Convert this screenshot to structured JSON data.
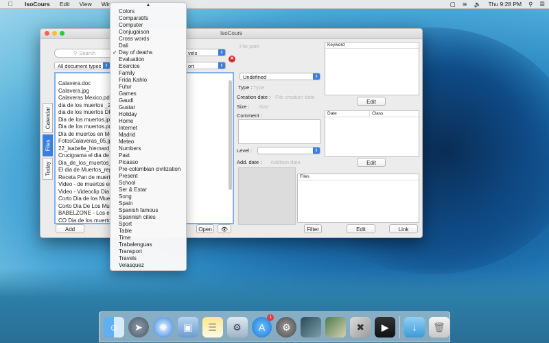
{
  "menubar": {
    "app_name": "IsoCours",
    "menus": [
      "Edit",
      "View",
      "Window"
    ],
    "clock": "Thu 9:28 PM"
  },
  "window": {
    "title": "IsoCours",
    "side_tabs": [
      "Calendar",
      "Files",
      "Today"
    ],
    "search_placeholder": "Search",
    "doc_type_select": "All document types",
    "level_select_partial": "vels",
    "sort_select_partial": "ort",
    "files": [
      "Calavera.doc",
      "Calavera.jpg",
      "Calaveras Mexico.pdf",
      "dia de los muertos _2.p",
      "dia de los muertos DF.j",
      "Dia de los muertos.jpg",
      "Dia de los muertos.pdf",
      "Dia de muertos en Mex",
      "FotosCalaveras_05.jpg",
      "22_isabelle_hiernard_d",
      "Crucigrama el dia de m",
      "Dia_de_los_muertos_",
      "El dia de Muertos_repa",
      "Receta Pan de muertos",
      "Video - de muertos en.",
      "Video - Videoclip Dia d",
      "Corto Dia de los Muert",
      "Corto Dia De Los Muer",
      "BABELZONE - Los esq",
      "CO Dia de los muertos"
    ],
    "buttons": {
      "add": "Add",
      "open": "Open",
      "edit_keyword": "Edit",
      "edit_date": "Edit",
      "filter": "Filter",
      "edit_files": "Edit",
      "link": "Link"
    },
    "detail": {
      "file_path_label": "File path",
      "status_select": "Undefined",
      "type_label": "Type :",
      "type_value": "Type",
      "creation_label": "Creation date :",
      "creation_value": "File creation date",
      "size_label": "Size :",
      "size_value": "Size",
      "comment_label": "Comment :",
      "level_label": "Level :",
      "add_date_label": "Add. date :",
      "add_date_value": "Addition date"
    },
    "tables": {
      "keyword_header": "Keyword",
      "date_header": "Date",
      "class_header": "Class",
      "files_header": "Files"
    }
  },
  "dropdown": {
    "checked": "Day of deaths",
    "options": [
      "Colors",
      "Comparatifs",
      "Computer",
      "Conjugaison",
      "Cross words",
      "Dali",
      "Day of deaths",
      "Evaluation",
      "Exercice",
      "Family",
      "Frida Kahlo",
      "Futur",
      "Games",
      "Gaudi",
      "Gustar",
      "Holiday",
      "Home",
      "Internet",
      "Madrid",
      "Meteo",
      "Numbers",
      "Past",
      "Picasso",
      "Pre-colombian civilization",
      "Present",
      "School",
      "Ser & Estar",
      "Song",
      "Spain",
      "Spanish famous",
      "Spannish cities",
      "Sport",
      "Table",
      "Time",
      "Trabalenguas",
      "Transport",
      "Travels",
      "Velasquez"
    ]
  },
  "dock": {
    "app_store_badge": "1",
    "icons": [
      "finder-icon",
      "launchpad-icon",
      "safari-icon",
      "preview-icon",
      "notes-icon",
      "photo-booth-icon",
      "app-store-icon",
      "system-preferences-icon",
      "photo-icon",
      "photo-stack-icon",
      "imovie-icon",
      "downloads-icon",
      "trash-icon"
    ]
  }
}
